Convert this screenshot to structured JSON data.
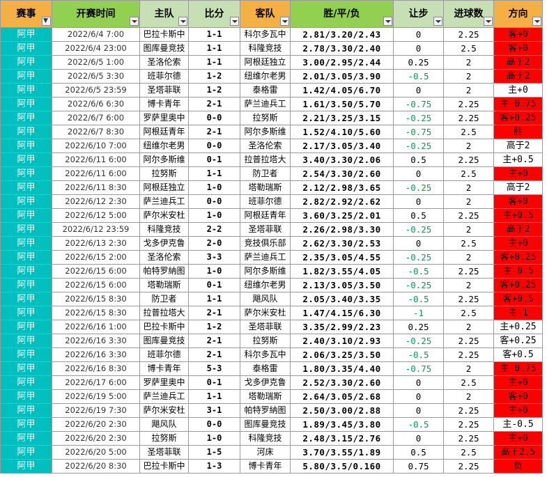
{
  "headers": {
    "league": "赛事",
    "kickoff": "开赛时间",
    "home": "主队",
    "score": "比分",
    "away": "客队",
    "odds": "胜/平/负",
    "handicap": "让步",
    "goals": "进球数",
    "direction": "方向"
  },
  "colors": {
    "header_orange": "#f4b042",
    "header_green": "#92d050",
    "league_teal": "#00bfbf",
    "highlight_red": "#ff0000",
    "negative_green": "#00a050"
  },
  "rows": [
    {
      "league": "阿甲",
      "time": "2022/6/4 7:00",
      "home": "巴拉卡斯中",
      "score": "1-1",
      "away": "科尔多瓦中",
      "odds": "2.81/3.20/2.43",
      "handicap": "0",
      "goals": "2.25",
      "direction": "客+0",
      "dir_color": "red"
    },
    {
      "league": "阿甲",
      "time": "2022/6/4 23:00",
      "home": "图库曼竞技",
      "score": "1-1",
      "away": "科隆竞技",
      "odds": "2.78/3.30/2.40",
      "handicap": "0",
      "goals": "2.5",
      "direction": "客+0",
      "dir_color": "red"
    },
    {
      "league": "阿甲",
      "time": "2022/6/5 1:00",
      "home": "圣洛伦索",
      "score": "1-1",
      "away": "阿根廷独立",
      "odds": "3.00/2.95/2.44",
      "handicap": "0.25",
      "goals": "2",
      "direction": "高于2",
      "dir_color": "red"
    },
    {
      "league": "阿甲",
      "time": "2022/6/5 3:30",
      "home": "班菲尔德",
      "score": "1-2",
      "away": "纽维尔老男",
      "odds": "2.01/3.05/3.90",
      "handicap": "-0.5",
      "goals": "2",
      "direction": "高于2",
      "dir_color": "red"
    },
    {
      "league": "阿甲",
      "time": "2022/6/5 23:59",
      "home": "圣塔菲联",
      "score": "1-2",
      "away": "泰格雷",
      "odds": "1.42/4.05/6.70",
      "handicap": "0",
      "goals": "2",
      "direction": "主+0",
      "dir_color": "white"
    },
    {
      "league": "阿甲",
      "time": "2022/6/6 6:30",
      "home": "博卡青年",
      "score": "2-1",
      "away": "萨兰迪兵工",
      "odds": "1.61/3.50/5.70",
      "handicap": "-0.75",
      "goals": "2.25",
      "direction": "主-0.75",
      "dir_color": "red"
    },
    {
      "league": "阿甲",
      "time": "2022/6/7 6:00",
      "home": "罗萨里奥中",
      "score": "0-0",
      "away": "拉努斯",
      "odds": "2.21/3.25/3.15",
      "handicap": "-0.25",
      "goals": "2.25",
      "direction": "客+0.25",
      "dir_color": "red"
    },
    {
      "league": "阿甲",
      "time": "2022/6/7 8:30",
      "home": "阿根廷青年",
      "score": "2-1",
      "away": "阿尔多斯维",
      "odds": "1.52/4.10/5.60",
      "handicap": "-0.75",
      "goals": "2.5",
      "direction": "胜",
      "dir_color": "red"
    },
    {
      "league": "阿甲",
      "time": "2022/6/10 7:00",
      "home": "纽维尔老男",
      "score": "0-0",
      "away": "圣洛伦索",
      "odds": "2.17/3.05/3.40",
      "handicap": "-0.25",
      "goals": "2",
      "direction": "高于2",
      "dir_color": "white"
    },
    {
      "league": "阿甲",
      "time": "2022/6/11 6:00",
      "home": "阿尔多斯维",
      "score": "0-1",
      "away": "拉普拉塔大",
      "odds": "3.40/3.30/2.06",
      "handicap": "0.5",
      "goals": "2.25",
      "direction": "主+0.5",
      "dir_color": "white"
    },
    {
      "league": "阿甲",
      "time": "2022/6/11 6:00",
      "home": "拉努斯",
      "score": "1-1",
      "away": "防卫者",
      "odds": "2.54/3.30/2.60",
      "handicap": "0",
      "goals": "2.5",
      "direction": "主+0",
      "dir_color": "red"
    },
    {
      "league": "阿甲",
      "time": "2022/6/11 8:30",
      "home": "阿根廷独立",
      "score": "1-0",
      "away": "塔勒瑞斯",
      "odds": "2.12/2.98/3.65",
      "handicap": "-0.25",
      "goals": "2",
      "direction": "高于2",
      "dir_color": "white"
    },
    {
      "league": "阿甲",
      "time": "2022/6/12 2:30",
      "home": "萨兰迪兵工",
      "score": "0-0",
      "away": "班菲尔德",
      "odds": "2.82/2.92/2.62",
      "handicap": "0",
      "goals": "2",
      "direction": "客+0",
      "dir_color": "red"
    },
    {
      "league": "阿甲",
      "time": "2022/6/12 5:00",
      "home": "萨尔米安杜",
      "score": "1-0",
      "away": "阿根廷青年",
      "odds": "3.60/3.25/2.01",
      "handicap": "0.5",
      "goals": "2.25",
      "direction": "主+0.5",
      "dir_color": "red"
    },
    {
      "league": "阿甲",
      "time": "2022/6/12 23:59",
      "home": "科隆竞技",
      "score": "2-2",
      "away": "圣塔菲联",
      "odds": "2.26/2.98/3.30",
      "handicap": "-0.25",
      "goals": "2",
      "direction": "高于2",
      "dir_color": "red"
    },
    {
      "league": "阿甲",
      "time": "2022/6/13 2:30",
      "home": "戈多伊克鲁",
      "score": "2-0",
      "away": "竞技俱乐部",
      "odds": "2.62/3.30/2.53",
      "handicap": "0",
      "goals": "2.5",
      "direction": "主+0",
      "dir_color": "red"
    },
    {
      "league": "阿甲",
      "time": "2022/6/15 2:00",
      "home": "圣洛伦索",
      "score": "3-3",
      "away": "萨兰迪兵工",
      "odds": "2.35/3.05/4.55",
      "handicap": "-0.25",
      "goals": "2",
      "direction": "客+0.25",
      "dir_color": "red"
    },
    {
      "league": "阿甲",
      "time": "2022/6/15 6:00",
      "home": "帕特罗納图",
      "score": "1-0",
      "away": "阿尔多斯维",
      "odds": "1.82/3.55/4.05",
      "handicap": "-0.5",
      "goals": "2.25",
      "direction": "主-0.5",
      "dir_color": "red"
    },
    {
      "league": "阿甲",
      "time": "2022/6/15 6:00",
      "home": "塔勒瑞斯",
      "score": "0-1",
      "away": "纽维尔老男",
      "odds": "2.13/3.05/3.50",
      "handicap": "-0.25",
      "goals": "2",
      "direction": "客+0.25",
      "dir_color": "red"
    },
    {
      "league": "阿甲",
      "time": "2022/6/15 8:30",
      "home": "防卫者",
      "score": "1-1",
      "away": "飓风队",
      "odds": "2.05/3.40/3.35",
      "handicap": "-0.5",
      "goals": "2.25",
      "direction": "客+0.5",
      "dir_color": "red"
    },
    {
      "league": "阿甲",
      "time": "2022/6/15 8:30",
      "home": "拉普拉塔大",
      "score": "2-1",
      "away": "萨尔米安杜",
      "odds": "1.47/4.15/6.30",
      "handicap": "-1",
      "goals": "2.5",
      "direction": "主-1",
      "dir_color": "red"
    },
    {
      "league": "阿甲",
      "time": "2022/6/16 1:00",
      "home": "巴拉卡斯中",
      "score": "1-2",
      "away": "圣塔菲联",
      "odds": "3.35/2.99/2.23",
      "handicap": "0.25",
      "goals": "2",
      "direction": "主+0.25",
      "dir_color": "white"
    },
    {
      "league": "阿甲",
      "time": "2022/6/16 3:30",
      "home": "图库曼竞技",
      "score": "2-1",
      "away": "拉努斯",
      "odds": "2.40/3.10/2.93",
      "handicap": "-0.25",
      "goals": "2.25",
      "direction": "客+0.25",
      "dir_color": "white"
    },
    {
      "league": "阿甲",
      "time": "2022/6/16 3:30",
      "home": "班菲尔德",
      "score": "2-1",
      "away": "科尔多瓦中",
      "odds": "2.06/3.25/3.50",
      "handicap": "-0.5",
      "goals": "2.25",
      "direction": "客+0.5",
      "dir_color": "white"
    },
    {
      "league": "阿甲",
      "time": "2022/6/16 8:30",
      "home": "博卡青年",
      "score": "5-3",
      "away": "泰格雷",
      "odds": "1.80/3.35/4.40",
      "handicap": "-0.75",
      "goals": "2",
      "direction": "主-0.75",
      "dir_color": "red"
    },
    {
      "league": "阿甲",
      "time": "2022/6/17 6:00",
      "home": "罗萨里奥中",
      "score": "0-1",
      "away": "戈多伊克鲁",
      "odds": "2.52/3.30/2.60",
      "handicap": "0",
      "goals": "2.5",
      "direction": "主+0",
      "dir_color": "red"
    },
    {
      "league": "阿甲",
      "time": "2022/6/19 5:00",
      "home": "萨兰迪兵工",
      "score": "1-1",
      "away": "塔勒瑞斯",
      "odds": "2.64/3.05/2.68",
      "handicap": "0",
      "goals": "2",
      "direction": "客+0",
      "dir_color": "red"
    },
    {
      "league": "阿甲",
      "time": "2022/6/19 7:30",
      "home": "萨尔米安杜",
      "score": "3-1",
      "away": "帕特罗納图",
      "odds": "2.50/3.00/2.88",
      "handicap": "0",
      "goals": "2.25",
      "direction": "主+0",
      "dir_color": "red"
    },
    {
      "league": "阿甲",
      "time": "2022/6/20 2:30",
      "home": "飓风队",
      "score": "0-0",
      "away": "图库曼竞技",
      "odds": "1.89/3.45/3.80",
      "handicap": "-0.5",
      "goals": "2.25",
      "direction": "主-0.5",
      "dir_color": "white"
    },
    {
      "league": "阿甲",
      "time": "2022/6/20 2:30",
      "home": "拉努斯",
      "score": "1-0",
      "away": "科隆竞技",
      "odds": "2.48/3.15/2.76",
      "handicap": "0",
      "goals": "2.25",
      "direction": "主+0",
      "dir_color": "red"
    },
    {
      "league": "阿甲",
      "time": "2022/6/20 5:00",
      "home": "圣塔菲联",
      "score": "1-5",
      "away": "河床",
      "odds": "3.70/3.55/1.89",
      "handicap": "0.5",
      "goals": "2.5",
      "direction": "高于2.5",
      "dir_color": "red"
    },
    {
      "league": "阿甲",
      "time": "2022/6/20 8:30",
      "home": "巴拉卡斯中",
      "score": "1-3",
      "away": "博卡青年",
      "odds": "5.80/3.5/0.160",
      "handicap": "0.75",
      "goals": "2.25",
      "direction": "负",
      "dir_color": "red"
    }
  ]
}
